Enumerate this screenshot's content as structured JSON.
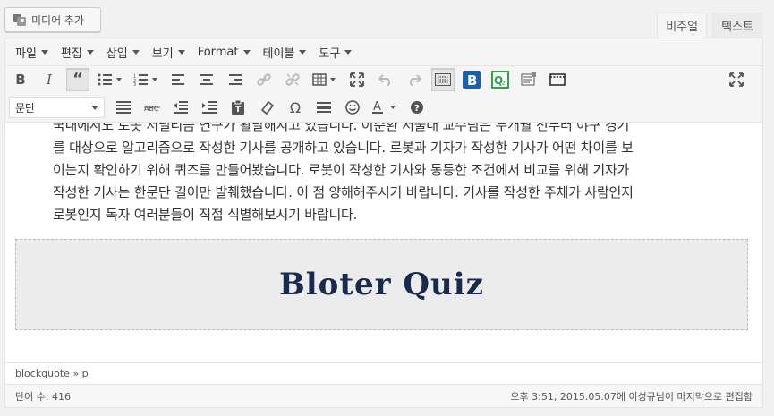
{
  "media_button": {
    "label": "미디어 추가",
    "icon": "media-icon"
  },
  "tabs": [
    {
      "label": "비주얼",
      "active": true
    },
    {
      "label": "텍스트",
      "active": false
    }
  ],
  "menubar": [
    "파일",
    "편집",
    "삽입",
    "보기",
    "Format",
    "테이블",
    "도구"
  ],
  "toolbar1": [
    "bold-icon",
    "italic-icon",
    "blockquote-icon",
    "bullet-list-icon",
    "numbered-list-icon",
    "align-left-icon",
    "align-center-icon",
    "align-right-icon",
    "link-icon",
    "unlink-icon",
    "table-icon",
    "fullscreen-icon",
    "undo-icon",
    "redo-icon",
    "toolbar-toggle-icon",
    "bold-b-plugin-icon",
    "quiz-plugin-icon",
    "insert-template-icon",
    "insert-media-icon",
    "distraction-free-icon"
  ],
  "toolbar2": {
    "format_select": "문단",
    "icons": [
      "justify-icon",
      "strikethrough-icon",
      "outdent-icon",
      "indent-icon",
      "paste-text-icon",
      "clear-format-icon",
      "omega-icon",
      "horizontal-rule-icon",
      "emoji-icon",
      "text-color-icon",
      "help-icon"
    ]
  },
  "content": {
    "lines": [
      "국내에서도 로봇 저널리즘 연구가 활발해지고 있습니다. 이준환 서울대 교수팀은 두개월 전부터 야구 경기",
      "를 대상으로 알고리즘으로 작성한 기사를 공개하고 있습니다. 로봇과 기자가 작성한 기사가 어떤 차이를 보",
      "이는지 확인하기 위해 퀴즈를 만들어봤습니다. 로봇이 작성한 기사와 동등한 조건에서 비교를 위해 기자가",
      "작성한 기사는 한문단 길이만 발췌했습니다. 이 점 양해해주시기 바랍니다. 기사를 작성한 주체가 사람인지",
      "로봇인지 독자 여러분들이 직접 식별해보시기 바랍니다."
    ],
    "quiz_image_text": "Bloter Quiz"
  },
  "status_path": "blockquote » p",
  "word_count": "단어 수: 416",
  "last_edited": "오후 3:51, 2015.05.07에 이성규님이 마지막으로 편집함",
  "colors": {
    "accent": "#2271b1",
    "quiz_title": "#1a2a4e",
    "plugin_b": "#1b5fa8",
    "plugin_q": "#2ea44f"
  }
}
